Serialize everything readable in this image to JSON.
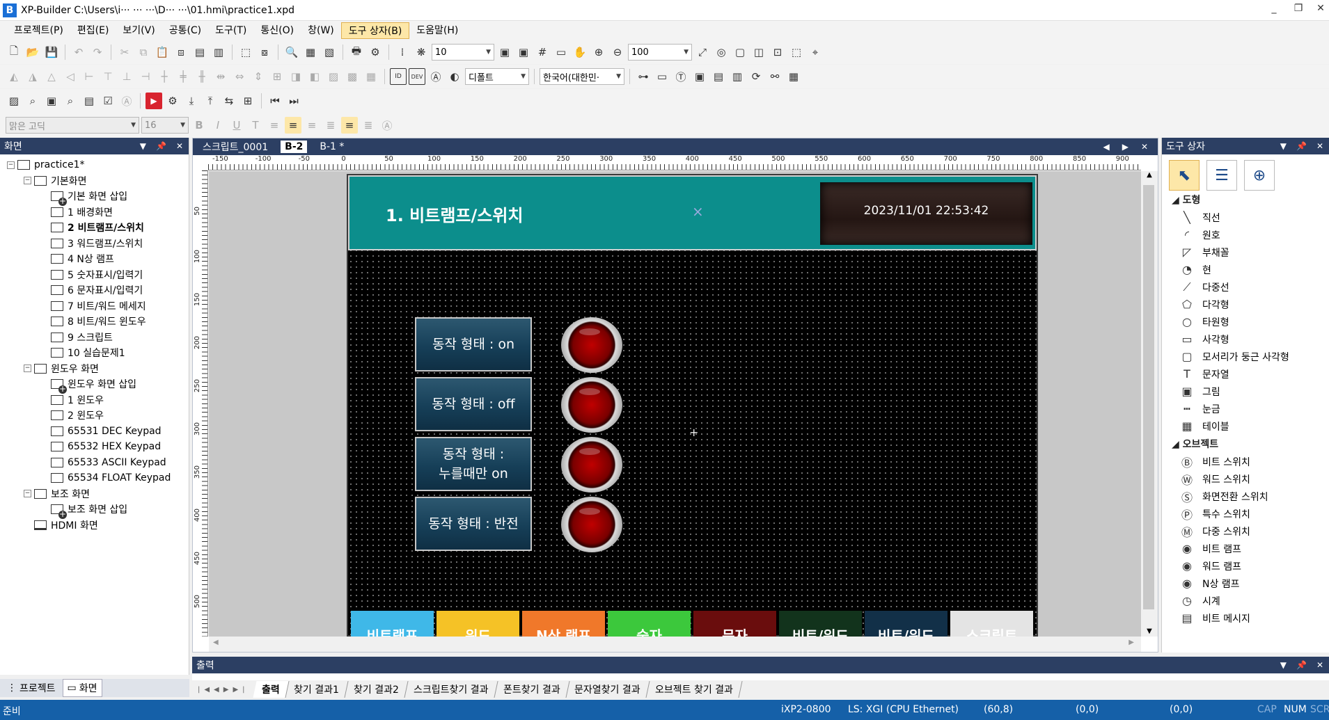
{
  "titlebar": {
    "logo": "B",
    "title": "XP-Builder C:\\Users\\i··· ··· ···\\D··· ···\\01.hmi\\practice1.xpd",
    "controls": [
      "_",
      "❐",
      "✕"
    ]
  },
  "menu": [
    "프로젝트(P)",
    "편집(E)",
    "보기(V)",
    "공통(C)",
    "도구(T)",
    "통신(O)",
    "창(W)",
    "도구 상자(B)",
    "도움말(H)"
  ],
  "toolbar1": {
    "grid_size": "10",
    "zoom": "100"
  },
  "toolbar2": {
    "style_combo": "디폴트",
    "language_combo": "한국어(대한민·"
  },
  "toolbar4": {
    "font_combo": "맑은 고딕",
    "size_combo": "16"
  },
  "left_panel": {
    "title": "화면",
    "tree": [
      {
        "label": "practice1*",
        "level": 0,
        "expander": "−",
        "icon": "project-icon"
      },
      {
        "label": "기본화면",
        "level": 1,
        "expander": "−",
        "icon": "screen-folder-icon"
      },
      {
        "label": "기본 화면 삽입",
        "level": 2,
        "icon": "insert-screen-icon"
      },
      {
        "label": "1 배경화면",
        "level": 2,
        "icon": "screen-icon"
      },
      {
        "label": "2 비트램프/스위치",
        "level": 2,
        "icon": "screen-icon",
        "bold": true
      },
      {
        "label": "3 워드램프/스위치",
        "level": 2,
        "icon": "screen-icon"
      },
      {
        "label": "4 N상 램프",
        "level": 2,
        "icon": "screen-icon"
      },
      {
        "label": "5 숫자표시/입력기",
        "level": 2,
        "icon": "screen-icon"
      },
      {
        "label": "6 문자표시/입력기",
        "level": 2,
        "icon": "screen-icon"
      },
      {
        "label": "7 비트/워드 메세지",
        "level": 2,
        "icon": "screen-icon"
      },
      {
        "label": "8 비트/워드 윈도우",
        "level": 2,
        "icon": "screen-icon"
      },
      {
        "label": "9 스크립트",
        "level": 2,
        "icon": "screen-icon"
      },
      {
        "label": "10 실습문제1",
        "level": 2,
        "icon": "screen-icon"
      },
      {
        "label": "윈도우 화면",
        "level": 1,
        "expander": "−",
        "icon": "window-folder-icon"
      },
      {
        "label": "윈도우 화면 삽입",
        "level": 2,
        "icon": "insert-screen-icon"
      },
      {
        "label": "1 윈도우",
        "level": 2,
        "icon": "window-icon"
      },
      {
        "label": "2 윈도우",
        "level": 2,
        "icon": "window-icon"
      },
      {
        "label": "65531 DEC Keypad",
        "level": 2,
        "icon": "window-icon"
      },
      {
        "label": "65532 HEX Keypad",
        "level": 2,
        "icon": "window-icon"
      },
      {
        "label": "65533 ASCII Keypad",
        "level": 2,
        "icon": "window-icon"
      },
      {
        "label": "65534 FLOAT Keypad",
        "level": 2,
        "icon": "window-icon"
      },
      {
        "label": "보조 화면",
        "level": 1,
        "expander": "−",
        "icon": "sub-folder-icon"
      },
      {
        "label": "보조 화면 삽입",
        "level": 2,
        "icon": "insert-screen-icon"
      },
      {
        "label": "HDMI 화면",
        "level": 1,
        "icon": "monitor-icon"
      }
    ],
    "bottom_tabs": [
      "프로젝트",
      "화면"
    ]
  },
  "doc": {
    "tabs": [
      "스크립트_0001",
      "B-2",
      "B-1 *"
    ],
    "active_tab": 1,
    "hruler_labels": [
      "-150",
      "-100",
      "-50",
      "0",
      "50",
      "100",
      "150",
      "200",
      "250",
      "300",
      "350",
      "400",
      "450",
      "500",
      "550",
      "600",
      "650",
      "700",
      "750",
      "800",
      "850",
      "900"
    ],
    "vruler_labels": [
      "50",
      "100",
      "150",
      "200",
      "250",
      "300",
      "350",
      "400",
      "450",
      "500"
    ]
  },
  "hmi": {
    "title": "1. 비트램프/스위치",
    "center_mark": "×",
    "clock": "2023/11/01    22:53:42",
    "switches": [
      "동작 형태 : on",
      "동작 형태 : off",
      "동작 형태 :\n누를때만 on",
      "동작 형태 : 반전"
    ],
    "nav_buttons": [
      {
        "label": "비트램프",
        "color": "#3fb8e8"
      },
      {
        "label": "워드",
        "color": "#f5c226"
      },
      {
        "label": "N상 램프",
        "color": "#f0782a"
      },
      {
        "label": "숫자",
        "color": "#3cc83c"
      },
      {
        "label": "문자",
        "color": "#6a0d0d"
      },
      {
        "label": "비트/워드",
        "color": "#12331c"
      },
      {
        "label": "비트/워드",
        "color": "#123048"
      },
      {
        "label": "스크립트",
        "color": "#e4e4e4"
      }
    ],
    "colors": {
      "header": "#0c8e8c",
      "lamp": "#b00000"
    }
  },
  "right_panel": {
    "title": "도구 상자",
    "shapes_title": "도형",
    "shapes": [
      {
        "label": "직선",
        "icon": "line-icon"
      },
      {
        "label": "원호",
        "icon": "arc-icon"
      },
      {
        "label": "부채꼴",
        "icon": "sector-icon"
      },
      {
        "label": "현",
        "icon": "chord-icon"
      },
      {
        "label": "다중선",
        "icon": "polyline-icon"
      },
      {
        "label": "다각형",
        "icon": "polygon-icon"
      },
      {
        "label": "타원형",
        "icon": "ellipse-icon"
      },
      {
        "label": "사각형",
        "icon": "rect-icon"
      },
      {
        "label": "모서리가 둥근 사각형",
        "icon": "rounded-rect-icon"
      },
      {
        "label": "문자열",
        "icon": "text-icon"
      },
      {
        "label": "그림",
        "icon": "image-icon"
      },
      {
        "label": "눈금",
        "icon": "scale-icon"
      },
      {
        "label": "테이블",
        "icon": "table-icon"
      }
    ],
    "objects_title": "오브젝트",
    "objects": [
      {
        "label": "비트 스위치",
        "icon": "bit-switch-icon"
      },
      {
        "label": "워드 스위치",
        "icon": "word-switch-icon"
      },
      {
        "label": "화면전환 스위치",
        "icon": "screen-switch-icon"
      },
      {
        "label": "특수 스위치",
        "icon": "special-switch-icon"
      },
      {
        "label": "다중 스위치",
        "icon": "multi-switch-icon"
      },
      {
        "label": "비트 램프",
        "icon": "bit-lamp-icon"
      },
      {
        "label": "워드 램프",
        "icon": "word-lamp-icon"
      },
      {
        "label": "N상 램프",
        "icon": "n-lamp-icon"
      },
      {
        "label": "시계",
        "icon": "clock-icon"
      },
      {
        "label": "비트 메시지",
        "icon": "bit-message-icon"
      }
    ]
  },
  "output": {
    "title": "출력",
    "tabs": [
      "출력",
      "찾기 결과1",
      "찾기 결과2",
      "스크립트찾기 결과",
      "폰트찾기 결과",
      "문자열찾기 결과",
      "오브젝트 찾기 결과"
    ]
  },
  "status": {
    "ready": "준비",
    "device": "iXP2-0800",
    "plc": "LS: XGI (CPU Ethernet)",
    "coord1": "(60,8)",
    "coord2": "(0,0)",
    "coord3": "(0,0)",
    "cap": "CAP",
    "num": "NUM",
    "scr": "SCR"
  }
}
